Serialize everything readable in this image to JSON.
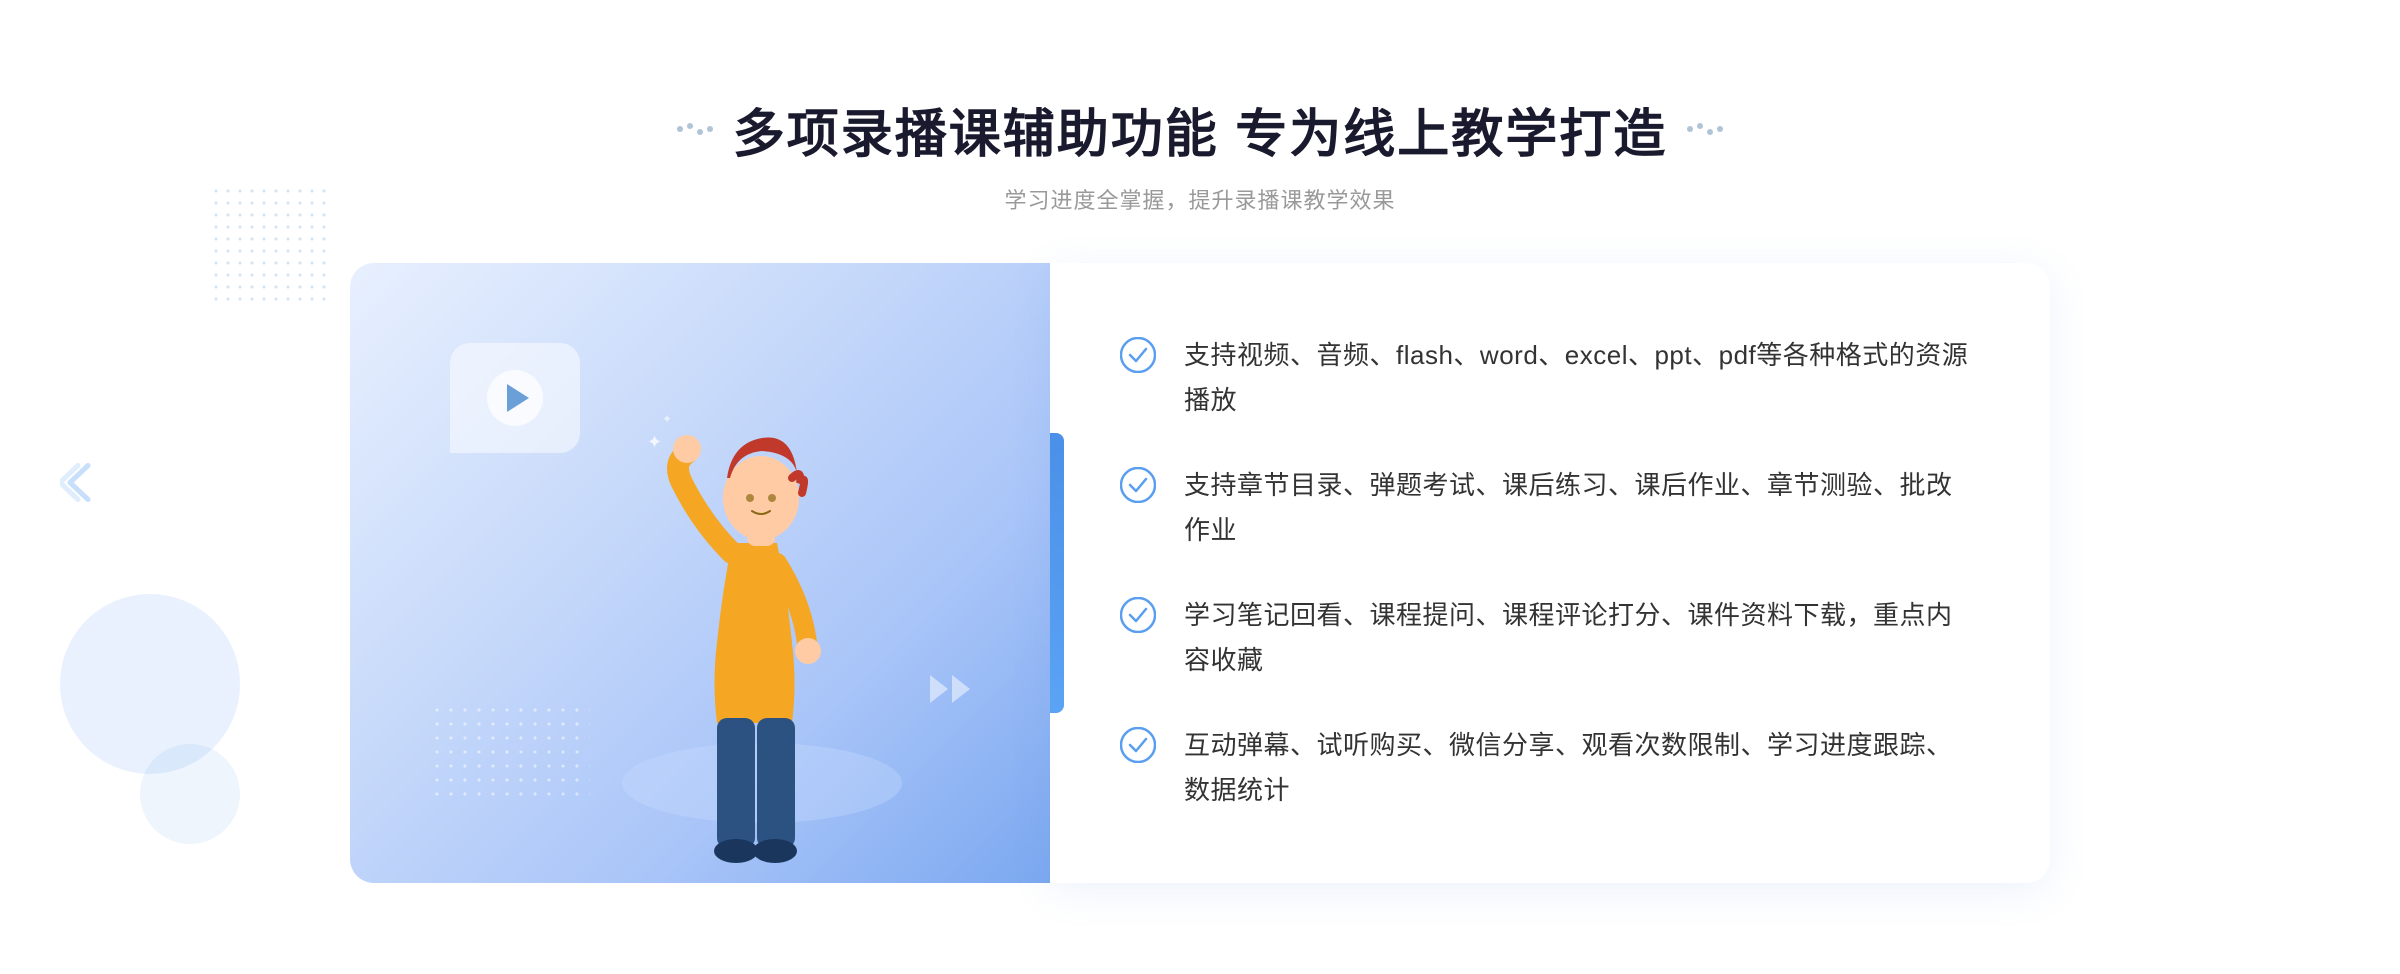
{
  "page": {
    "background": "#ffffff"
  },
  "header": {
    "title": "多项录播课辅助功能 专为线上教学打造",
    "subtitle": "学习进度全掌握，提升录播课教学效果",
    "title_part1": "多项录播课辅助功能 专为线上教学打造"
  },
  "features": [
    {
      "id": 1,
      "text": "支持视频、音频、flash、word、excel、ppt、pdf等各种格式的资源播放"
    },
    {
      "id": 2,
      "text": "支持章节目录、弹题考试、课后练习、课后作业、章节测验、批改作业"
    },
    {
      "id": 3,
      "text": "学习笔记回看、课程提问、课程评论打分、课件资料下载，重点内容收藏"
    },
    {
      "id": 4,
      "text": "互动弹幕、试听购买、微信分享、观看次数限制、学习进度跟踪、数据统计"
    }
  ],
  "colors": {
    "primary_blue": "#4a8fe8",
    "light_blue": "#7ab3f5",
    "title_dark": "#1a1a2e",
    "text_gray": "#333333",
    "subtitle_gray": "#999999",
    "check_circle": "#5a9ef0"
  }
}
